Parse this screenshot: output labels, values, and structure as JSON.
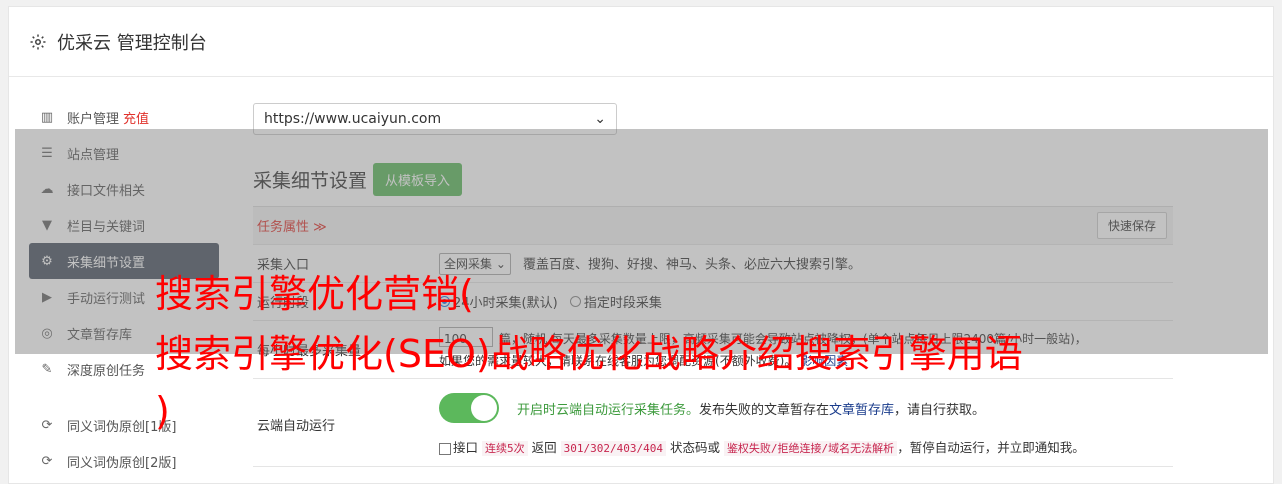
{
  "header": {
    "title": "优采云 管理控制台",
    "icon": "gear-icon"
  },
  "sidebar": {
    "items": [
      {
        "label": "账户管理",
        "extra": "充值",
        "icon": "bar-chart-icon"
      },
      {
        "label": "站点管理",
        "icon": "server-icon"
      },
      {
        "label": "接口文件相关",
        "icon": "cloud-upload-icon"
      },
      {
        "label": "栏目与关键词",
        "icon": "filter-icon"
      },
      {
        "label": "采集细节设置",
        "icon": "gears-icon",
        "active": true
      },
      {
        "label": "手动运行测试",
        "icon": "play-circle-icon"
      },
      {
        "label": "文章暂存库",
        "icon": "database-icon"
      },
      {
        "label": "深度原创任务",
        "icon": "edit-icon"
      },
      {
        "label": "同义词伪原创[1版]",
        "icon": "refresh-icon"
      },
      {
        "label": "同义词伪原创[2版]",
        "icon": "refresh-icon"
      }
    ]
  },
  "main": {
    "site_select": "https://www.ucaiyun.com",
    "section_title": "采集细节设置",
    "import_button": "从模板导入",
    "task_attr": "任务属性 ≫",
    "quick_save": "快速保存",
    "rows": {
      "entry_label": "采集入口",
      "entry_select": "全网采集",
      "entry_desc": "覆盖百度、搜狗、好搜、神马、头条、必应六大搜索引擎。",
      "time_label": "运行时段",
      "time_opt1": "24小时采集(默认)",
      "time_opt2": "指定时段采集",
      "count_label": "每小时最多采集量",
      "count_value": "100",
      "count_desc": "篇，随机 每天最多采集数量上限，高频采集可能会导致站点被降权，(单个站点每日上限2400篇/小时一般站)，",
      "count_desc2": "如果您的需求量较大，请联系在线客服为您调配资源(不额外收费)。",
      "count_link": "影响因素",
      "cloud_label": "云端自动运行",
      "cloud_desc_green": "开启时云端自动运行采集任务。",
      "cloud_desc": "发布失败的文章暂存在",
      "cloud_link": "文章暂存库",
      "cloud_desc2": "，请自行获取。",
      "iface_label": "接口",
      "iface_code1": "连续5次",
      "iface_ret": "返回",
      "iface_code2": "301/302/403/404",
      "iface_status": "状态码或",
      "iface_code3": "鉴权失败/拒绝连接/域名无法解析",
      "iface_end": "，暂停自动运行，并立即通知我。"
    }
  },
  "watermark": {
    "line1": "搜索引擎优化营销(",
    "line2": "搜索引擎优化(SEO)战略优化战略介绍搜索引擎用语",
    "line3": ")"
  },
  "colors": {
    "accent_green": "#5cb85c",
    "watermark_red": "#ff0000",
    "active_bg": "#4b5563",
    "recharge_red": "#e0312b"
  }
}
